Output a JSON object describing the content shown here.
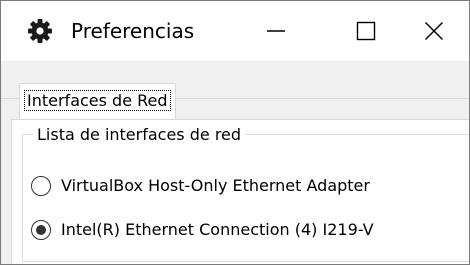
{
  "window": {
    "title": "Preferencias",
    "icon": "gear-icon",
    "controls": [
      "minimize-icon",
      "maximize-icon",
      "close-icon"
    ]
  },
  "tabs": [
    {
      "label": "Interfaces de Red",
      "selected": true
    }
  ],
  "panel": {
    "group_title": "Lista de interfaces de red",
    "options": [
      {
        "label": "VirtualBox Host-Only Ethernet Adapter",
        "selected": false
      },
      {
        "label": "Intel(R) Ethernet Connection (4) I219-V",
        "selected": true
      }
    ]
  },
  "colors": {
    "titlebar": "#ffffff",
    "body": "#f0f0f0",
    "border": "#d9d9d9",
    "text": "#000000"
  }
}
